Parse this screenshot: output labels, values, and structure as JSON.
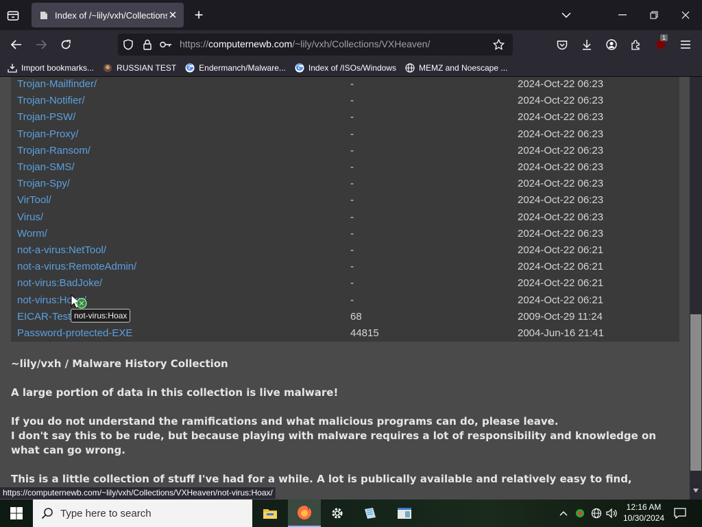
{
  "browser": {
    "tab_title": "Index of /~lily/vxh/Collections/",
    "url_base": "https://",
    "url_domain": "computernewb.com",
    "url_path": "/~lily/vxh/Collections/VXHeaven/",
    "extension_badge": "1"
  },
  "bookmarks": [
    {
      "label": "Import bookmarks...",
      "icon": "import-icon"
    },
    {
      "label": "RUSSIAN TEST",
      "icon": "site-icon"
    },
    {
      "label": "Endermanch/Malware...",
      "icon": "google-icon"
    },
    {
      "label": "Index of /ISOs/Windows",
      "icon": "google-icon"
    },
    {
      "label": "MEMZ and Noescape ...",
      "icon": "globe-icon"
    }
  ],
  "listing": [
    {
      "name": "Trojan-Mailfinder/",
      "size": "-",
      "date": "2024-Oct-22 06:23"
    },
    {
      "name": "Trojan-Notifier/",
      "size": "-",
      "date": "2024-Oct-22 06:23"
    },
    {
      "name": "Trojan-PSW/",
      "size": "-",
      "date": "2024-Oct-22 06:23"
    },
    {
      "name": "Trojan-Proxy/",
      "size": "-",
      "date": "2024-Oct-22 06:23"
    },
    {
      "name": "Trojan-Ransom/",
      "size": "-",
      "date": "2024-Oct-22 06:23"
    },
    {
      "name": "Trojan-SMS/",
      "size": "-",
      "date": "2024-Oct-22 06:23"
    },
    {
      "name": "Trojan-Spy/",
      "size": "-",
      "date": "2024-Oct-22 06:23"
    },
    {
      "name": "VirTool/",
      "size": "-",
      "date": "2024-Oct-22 06:23"
    },
    {
      "name": "Virus/",
      "size": "-",
      "date": "2024-Oct-22 06:23"
    },
    {
      "name": "Worm/",
      "size": "-",
      "date": "2024-Oct-22 06:23"
    },
    {
      "name": "not-a-virus:NetTool/",
      "size": "-",
      "date": "2024-Oct-22 06:21"
    },
    {
      "name": "not-a-virus:RemoteAdmin/",
      "size": "-",
      "date": "2024-Oct-22 06:21"
    },
    {
      "name": "not-virus:BadJoke/",
      "size": "-",
      "date": "2024-Oct-22 06:21"
    },
    {
      "name": "not-virus:Hoax/",
      "size": "-",
      "date": "2024-Oct-22 06:21"
    },
    {
      "name": "EICAR-Test",
      "size": "68",
      "date": "2009-Oct-29 11:24"
    },
    {
      "name": "Password-protected-EXE",
      "size": "44815",
      "date": "2004-Jun-16 21:41"
    }
  ],
  "tooltip": "not-virus:Hoax",
  "about": {
    "heading": "~lily/vxh / Malware History Collection",
    "warning": "A large portion of data in this collection is live malware!",
    "advice_1": "If you do not understand the ramifications and what malicious programs can do, please leave.",
    "advice_2": "I don't say this to be rude, but because playing with malware requires a lot of responsibility and knowledge on what can go wrong.",
    "intro": "This is a little collection of stuff I've had for a while. A lot is publically available and relatively easy to find,"
  },
  "status_url": "https://computernewb.com/~lily/vxh/Collections/VXHeaven/not-virus:Hoax/",
  "taskbar": {
    "search_placeholder": "Type here to search",
    "time": "12:16 AM",
    "date": "10/30/2024",
    "apps": [
      "file-explorer-icon",
      "firefox-icon",
      "settings-icon",
      "notepad-icon",
      "window-app-icon"
    ]
  }
}
